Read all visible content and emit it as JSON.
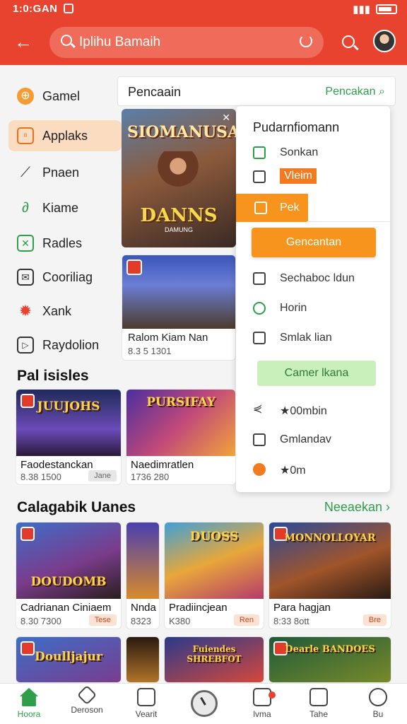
{
  "status": {
    "time": "1:0:GAN"
  },
  "appbar": {
    "search_text": "Iplihu Bamaih"
  },
  "sidebar": {
    "items": [
      {
        "label": "Gamel",
        "icon": "gamepad-icon",
        "active": false
      },
      {
        "label": "Applaks",
        "icon": "app-square-icon",
        "active": true
      },
      {
        "label": "Pnaen",
        "icon": "wrench-icon",
        "active": false
      },
      {
        "label": "Kiame",
        "icon": "link-icon",
        "active": false
      },
      {
        "label": "Radles",
        "icon": "chart-icon",
        "active": false
      },
      {
        "label": "Cooriliag",
        "icon": "mail-icon",
        "active": false
      },
      {
        "label": "Xank",
        "icon": "gear-icon",
        "active": false
      },
      {
        "label": "Raydolion",
        "icon": "play-box-icon",
        "active": false
      }
    ]
  },
  "panel": {
    "title": "Pencaain",
    "link": "Pencakan"
  },
  "hero": {
    "title": "SIOMANUSAU",
    "subtitle": "DANNS",
    "small": "DAMUNG"
  },
  "card2": {
    "name": "Ralom Kiam Nan",
    "meta": "8.3 5 1301"
  },
  "dropdown": {
    "title": "Pudarnfiomann",
    "rows": [
      {
        "label": "Sonkan",
        "icon": "check-icon"
      },
      {
        "label": "Vleim",
        "icon": "clipboard-icon",
        "tag": true
      }
    ],
    "active": "Pek",
    "button": "Gencantan",
    "rows2": [
      {
        "label": "Sechaboc ldun",
        "icon": "doc-icon"
      },
      {
        "label": "Horin",
        "icon": "circle-icon"
      },
      {
        "label": "Smlak lian",
        "icon": "square-icon"
      }
    ],
    "green_button": "Camer lkana",
    "rows3": [
      {
        "label": "★00mbin",
        "icon": "share-icon"
      },
      {
        "label": "Gmlandav",
        "icon": "edit-icon"
      },
      {
        "label": "★0m",
        "icon": "cloud-icon"
      }
    ]
  },
  "section1": {
    "title": "Pal isisles",
    "cards": [
      {
        "art": "JUUJOHS",
        "title": "Faodestanckan",
        "meta": "8.38 1500",
        "tag": "Jane"
      },
      {
        "art": "PURSIFAY",
        "title": "Naedimratlen",
        "meta": "1736 280",
        "tag": ""
      }
    ]
  },
  "section2": {
    "title": "Calagabik Uanes",
    "link": "Neeaekan",
    "cards": [
      {
        "art": "DOUDOMB",
        "title": "Cadrianan Ciniaem",
        "meta": "8.30 7300",
        "tag": "Tese"
      },
      {
        "art": "",
        "title": "Nnda",
        "meta": "8323",
        "tag": ""
      },
      {
        "art": "DUOSS",
        "title": "Pradiincjean",
        "meta": "K380",
        "tag": "Ren"
      },
      {
        "art": "MONNOLLOYAR",
        "title": "Para hagjan",
        "meta": "8:33 8ott",
        "tag": "Bre"
      }
    ]
  },
  "section3": {
    "cards": [
      {
        "art": "Doulljajur"
      },
      {
        "art": ""
      },
      {
        "art": "Fuiendes SHREBFOT"
      },
      {
        "art": "Dearle BANDOES"
      }
    ]
  },
  "nav": {
    "items": [
      "Hoora",
      "Deroson",
      "Vearit",
      "",
      "lvma",
      "Tahe",
      "Bu"
    ]
  }
}
